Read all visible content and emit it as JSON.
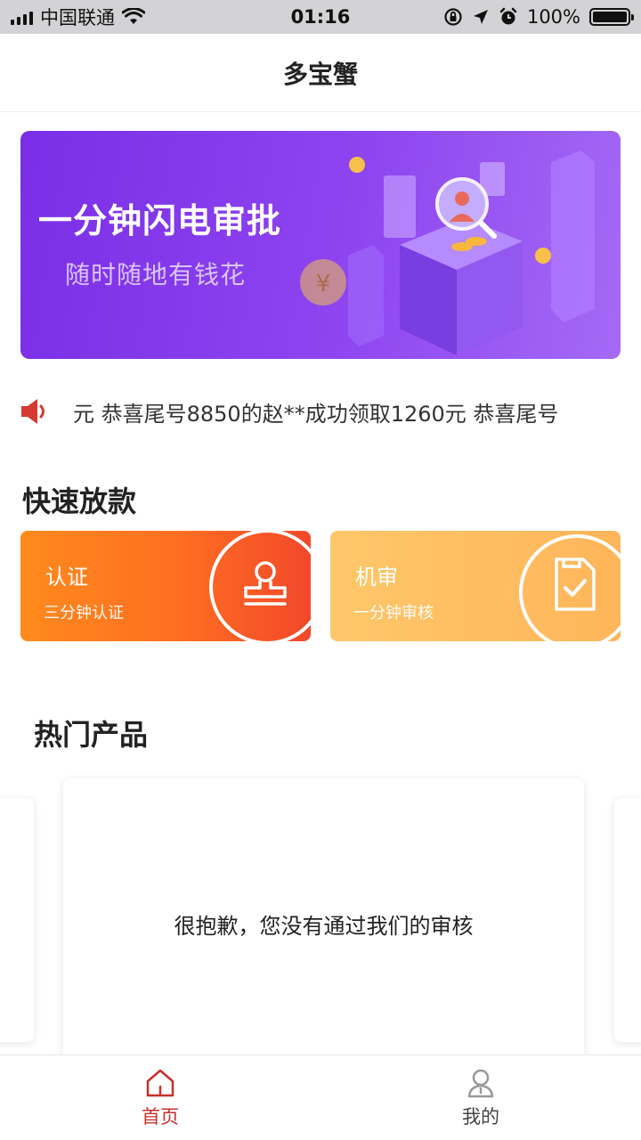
{
  "status_bar": {
    "carrier": "中国联通",
    "time": "01:16",
    "battery_percent": "100%",
    "battery_level": 1.0
  },
  "header": {
    "title": "多宝蟹"
  },
  "banner": {
    "title": "一分钟闪电审批",
    "subtitle": "随时随地有钱花",
    "colors": {
      "start": "#7a2ee6",
      "end": "#a46af5"
    }
  },
  "notice": {
    "text": "元 恭喜尾号8850的赵**成功领取1260元 恭喜尾号"
  },
  "quick_section": {
    "title": "快速放款",
    "cards": [
      {
        "title": "认证",
        "subtitle": "三分钟认证",
        "icon": "stamp-icon"
      },
      {
        "title": "机审",
        "subtitle": "一分钟审核",
        "icon": "document-check-icon"
      }
    ]
  },
  "hot_section": {
    "title": "热门产品",
    "message": "很抱歉，您没有通过我们的审核"
  },
  "tab_bar": {
    "items": [
      {
        "label": "首页",
        "icon": "home-icon",
        "active": true,
        "color": "#c9302c"
      },
      {
        "label": "我的",
        "icon": "user-icon",
        "active": false,
        "color": "#444444"
      }
    ]
  }
}
